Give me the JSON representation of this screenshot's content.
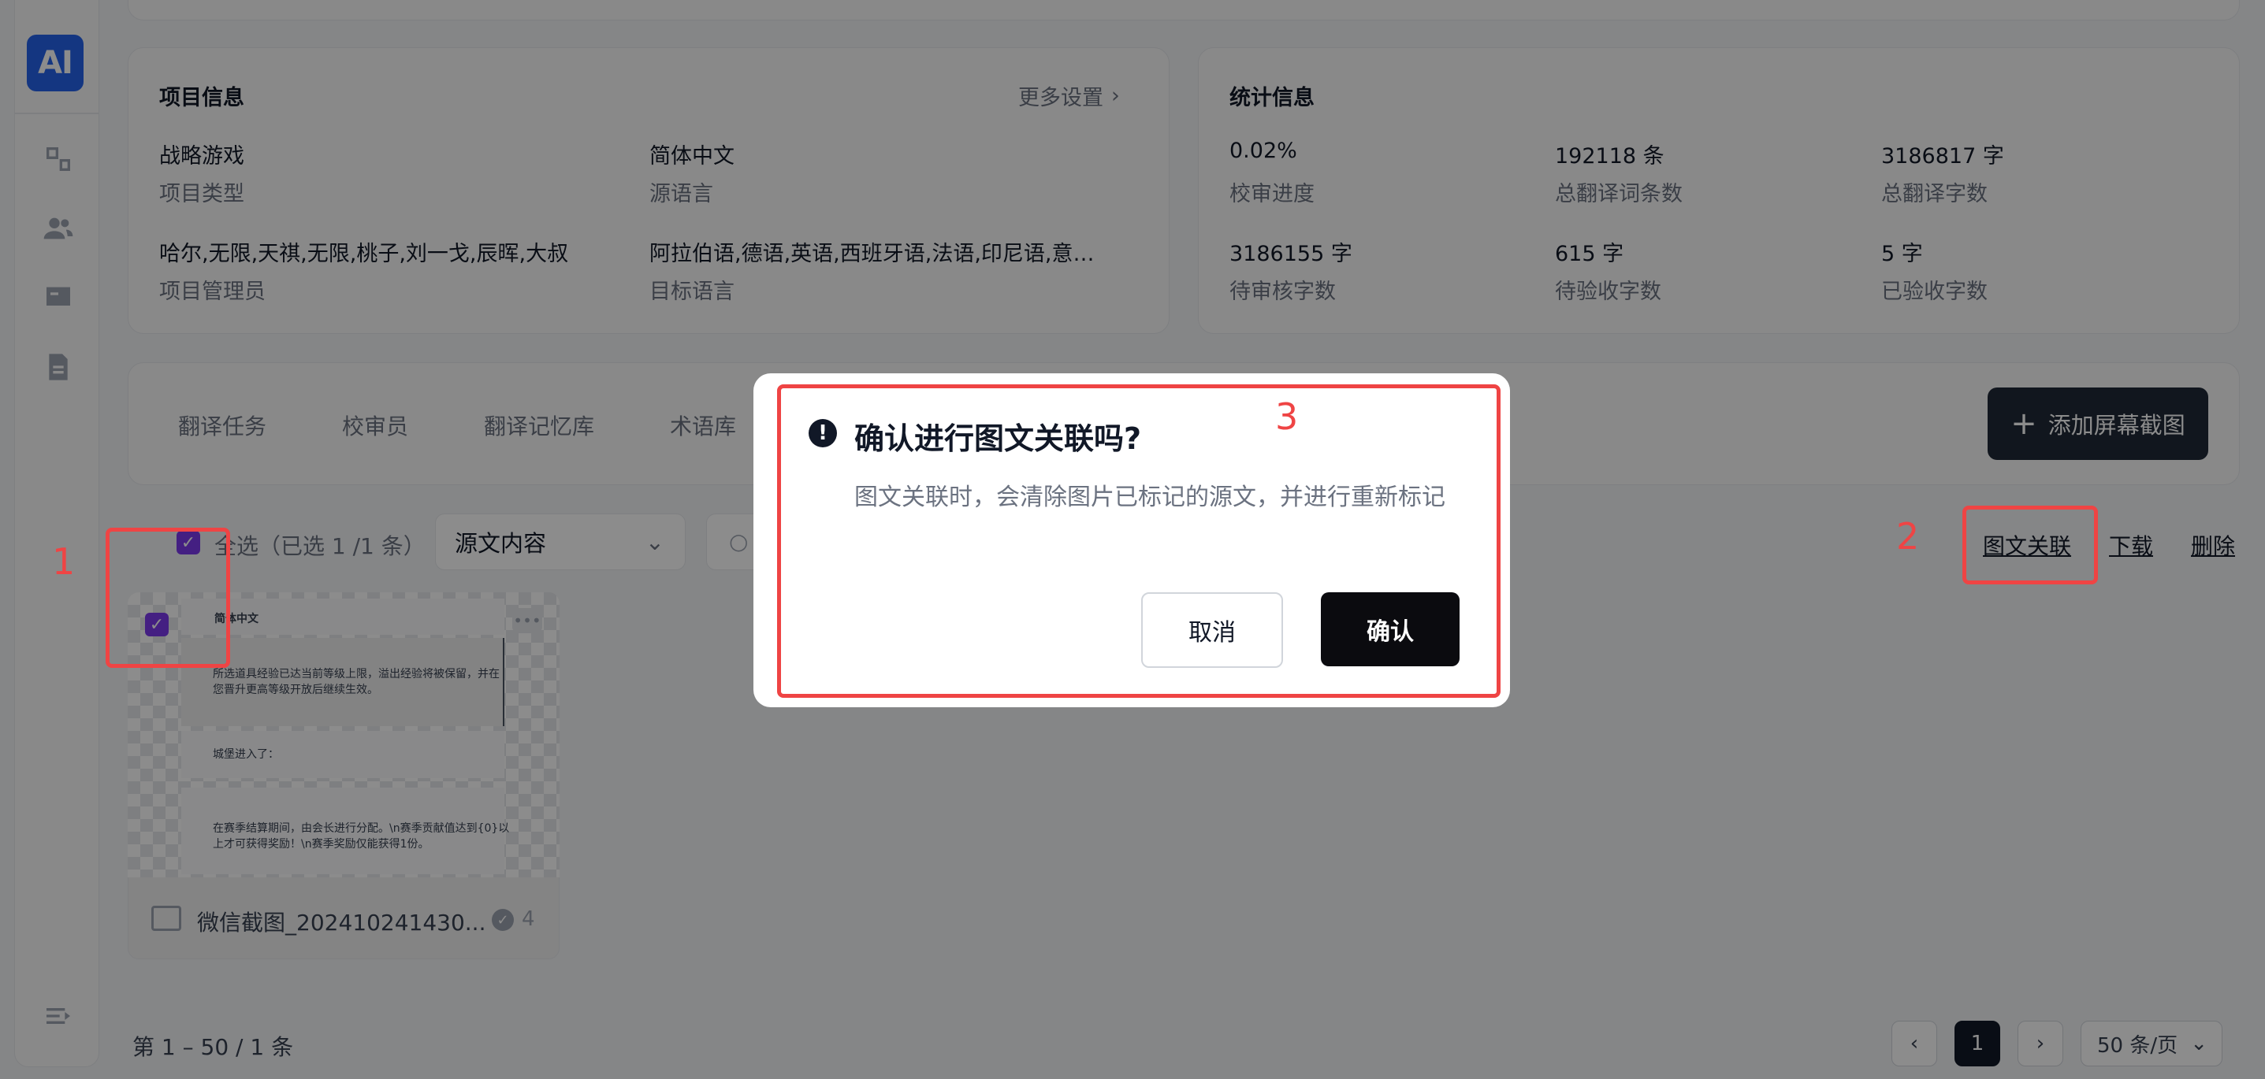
{
  "sidebar": {
    "logo": "AI",
    "icons": [
      "translate-icon",
      "users-icon",
      "monitor-icon",
      "document-icon"
    ],
    "bottom_icon": "collapse-icon"
  },
  "project_info": {
    "title": "项目信息",
    "more": "更多设置",
    "fields": [
      {
        "value": "战略游戏",
        "label": "项目类型"
      },
      {
        "value": "简体中文",
        "label": "源语言"
      },
      {
        "value": "哈尔,无限,天祺,无限,桃子,刘一戈,辰晖,大叔",
        "label": "项目管理员"
      },
      {
        "value": "阿拉伯语,德语,英语,西班牙语,法语,印尼语,意…",
        "label": "目标语言"
      }
    ]
  },
  "stats": {
    "title": "统计信息",
    "items": [
      {
        "value": "0.02%",
        "label": "校审进度"
      },
      {
        "value": "192118 条",
        "label": "总翻译词条数"
      },
      {
        "value": "3186817 字",
        "label": "总翻译字数"
      },
      {
        "value": "3186155 字",
        "label": "待审核字数"
      },
      {
        "value": "615 字",
        "label": "待验收字数"
      },
      {
        "value": "5 字",
        "label": "已验收字数"
      }
    ]
  },
  "tabs": [
    "翻译任务",
    "校审员",
    "翻译记忆库",
    "术语库"
  ],
  "add_button": "添加屏幕截图",
  "toolbar": {
    "select_all": "全选（已选 1 /1 条）",
    "dropdown_value": "源文内容",
    "actions": [
      "图文关联",
      "下载",
      "删除"
    ]
  },
  "image_card": {
    "header": "简体中文",
    "lines": [
      "所选道具经验已达当前等级上限，溢出经验将被保留，并在",
      "您晋升更高等级开放后继续生效。",
      "城堡进入了：",
      "在赛季结算期间，由会长进行分配。\\n赛季贡献值达到{0}以",
      "上才可获得奖励！\\n赛季奖励仅能获得1份。"
    ],
    "filename": "微信截图_202410241430...",
    "count": "4"
  },
  "footer": {
    "range": "第 1 – 50 / 1 条",
    "page": "1",
    "page_size": "50 条/页"
  },
  "modal": {
    "title": "确认进行图文关联吗?",
    "body": "图文关联时，会清除图片已标记的源文，并进行重新标记",
    "cancel": "取消",
    "confirm": "确认"
  },
  "annotations": [
    "1",
    "2",
    "3"
  ],
  "colors": {
    "accent": "#2563eb",
    "checkbox": "#7c3aed",
    "annotation": "#ef4444",
    "dark_button": "#0b0b0f"
  }
}
